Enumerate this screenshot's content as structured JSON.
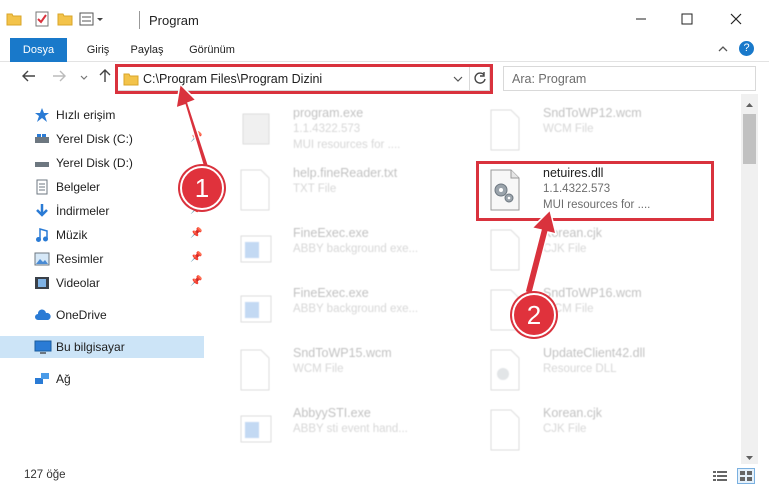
{
  "window": {
    "title": "Program"
  },
  "ribbon": {
    "tabs": [
      "Dosya",
      "Giriş",
      "Paylaş",
      "Görünüm"
    ]
  },
  "navigation": {
    "address": "C:\\Program Files\\Program Dizini",
    "search_placeholder": "Ara: Program"
  },
  "sidebar": {
    "items": [
      {
        "label": "Hızlı erişim",
        "icon": "star-icon"
      },
      {
        "label": "Yerel Disk (C:)",
        "icon": "drive-icon"
      },
      {
        "label": "Yerel Disk (D:)",
        "icon": "drive-icon"
      },
      {
        "label": "Belgeler",
        "icon": "documents-icon"
      },
      {
        "label": "İndirmeler",
        "icon": "download-icon"
      },
      {
        "label": "Müzik",
        "icon": "music-icon"
      },
      {
        "label": "Resimler",
        "icon": "pictures-icon"
      },
      {
        "label": "Videolar",
        "icon": "videos-icon"
      },
      {
        "label": "OneDrive",
        "icon": "cloud-icon"
      },
      {
        "label": "Bu bilgisayar",
        "icon": "computer-icon"
      },
      {
        "label": "Ağ",
        "icon": "network-icon"
      }
    ]
  },
  "files": [
    {
      "name": "program.exe",
      "type": "1.1.4322.573",
      "desc": "MUI resources for ...."
    },
    {
      "name": "SndToWP12.wcm",
      "type": "WCM File",
      "desc": ""
    },
    {
      "name": "help.fineReader.txt",
      "type": "TXT File",
      "desc": ""
    },
    {
      "name": "netuires.dll",
      "type": "1.1.4322.573",
      "desc": "MUI resources for ...."
    },
    {
      "name": "FineExec.exe",
      "type": "ABBY background exe...",
      "desc": ""
    },
    {
      "name": "Korean.cjk",
      "type": "CJK File",
      "desc": ""
    },
    {
      "name": "FineExec.exe",
      "type": "ABBY background exe...",
      "desc": ""
    },
    {
      "name": "SndToWP16.wcm",
      "type": "WCM File",
      "desc": ""
    },
    {
      "name": "SndToWP15.wcm",
      "type": "WCM File",
      "desc": ""
    },
    {
      "name": "UpdateClient42.dll",
      "type": "Resource DLL",
      "desc": ""
    },
    {
      "name": "AbbyySTI.exe",
      "type": "ABBY sti event hand...",
      "desc": ""
    },
    {
      "name": "Korean.cjk",
      "type": "CJK File",
      "desc": ""
    }
  ],
  "status": {
    "item_count": "127 öğe"
  },
  "annotations": {
    "step1": "1",
    "step2": "2",
    "color": "#d9323d"
  }
}
